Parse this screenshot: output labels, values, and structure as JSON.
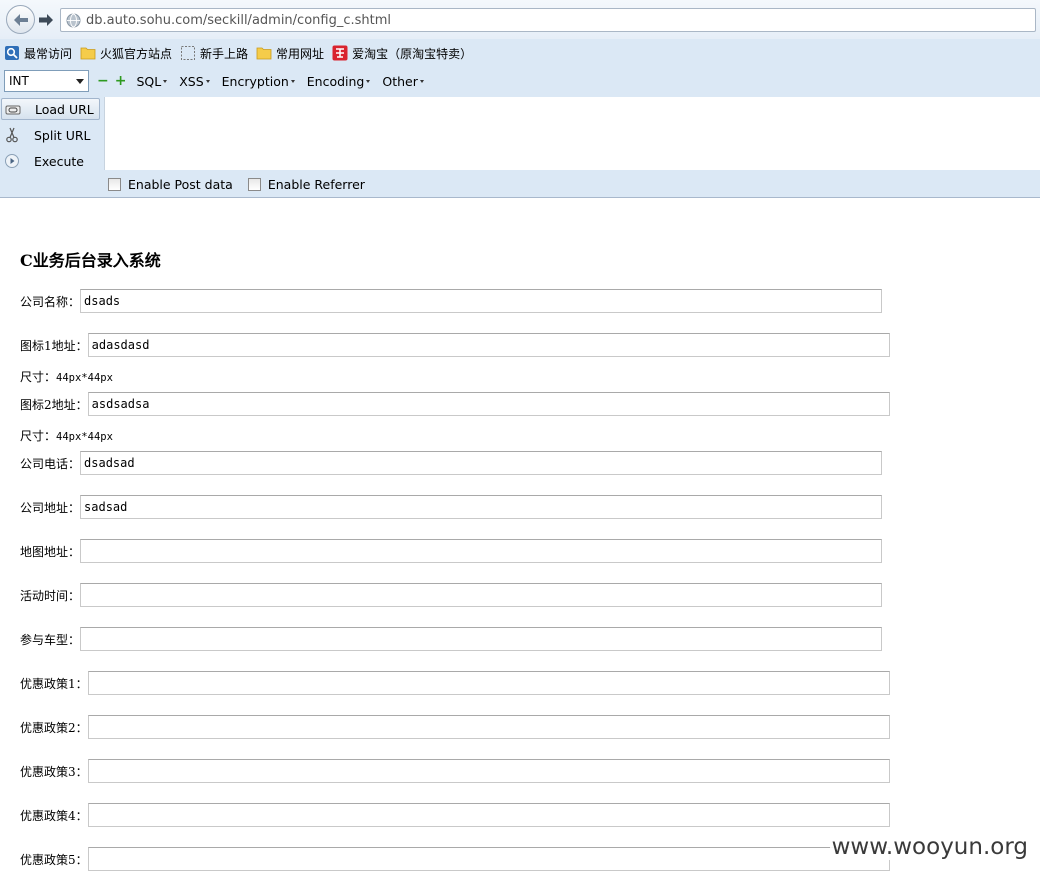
{
  "browser": {
    "url": "db.auto.sohu.com/seckill/admin/config_c.shtml",
    "bookmarks": [
      {
        "label": "最常访问",
        "icon": "most-visited-icon"
      },
      {
        "label": "火狐官方站点",
        "icon": "folder-icon"
      },
      {
        "label": "新手上路",
        "icon": "dashed-page-icon"
      },
      {
        "label": "常用网址",
        "icon": "folder-icon"
      },
      {
        "label": "爱淘宝（原淘宝特卖）",
        "icon": "taobao-icon"
      }
    ]
  },
  "hackbar": {
    "select_value": "INT",
    "menus": [
      "SQL",
      "XSS",
      "Encryption",
      "Encoding",
      "Other"
    ],
    "actions": {
      "load_url": "Load URL",
      "split_url": "Split URL",
      "execute": "Execute"
    },
    "options": {
      "post_data": "Enable Post data",
      "referrer": "Enable Referrer"
    },
    "colors": {
      "toolbar_bg": "#dbe8f5"
    }
  },
  "page": {
    "title": "C业务后台录入系统",
    "fields": [
      {
        "label": "公司名称：",
        "value": ""
      },
      {
        "label": "图标1地址：",
        "value": "adasdasd"
      },
      {
        "label": "图标2地址：",
        "value": "asdsadsa"
      },
      {
        "label": "公司电话：",
        "value": "dsadsad"
      },
      {
        "label": "公司地址：",
        "value": "sadsad"
      },
      {
        "label": "地图地址：",
        "value": ""
      },
      {
        "label": "活动时间：",
        "value": ""
      },
      {
        "label": "参与车型：",
        "value": ""
      },
      {
        "label": "优惠政策1：",
        "value": ""
      },
      {
        "label": "优惠政策2：",
        "value": ""
      },
      {
        "label": "优惠政策3：",
        "value": ""
      },
      {
        "label": "优惠政策4：",
        "value": ""
      },
      {
        "label": "优惠政策5：",
        "value": ""
      }
    ],
    "company_name_value": "dsads",
    "size_label": "尺寸：",
    "size_value": "44px*44px"
  },
  "watermark": "www.wooyun.org"
}
